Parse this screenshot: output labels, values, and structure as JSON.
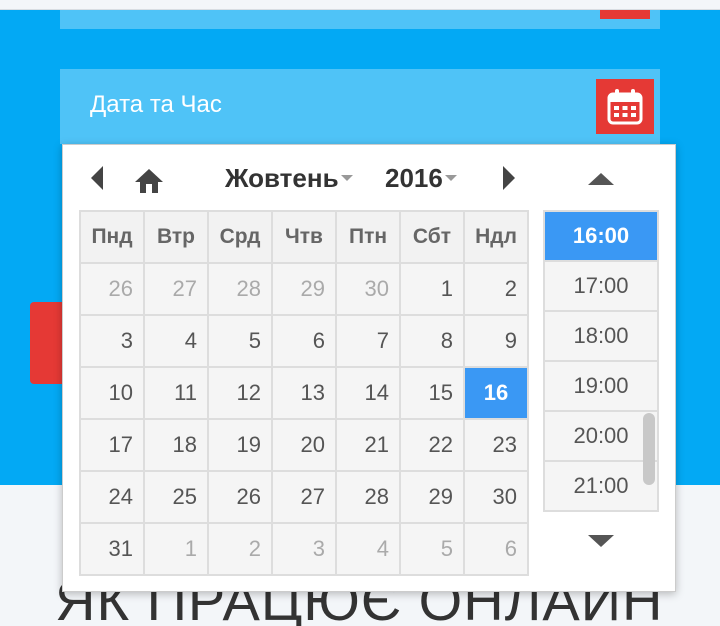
{
  "field": {
    "label": "Дата та Час",
    "calendar_icon": "calendar-icon"
  },
  "calendar": {
    "month": "Жовтень",
    "year": "2016",
    "weekdays": [
      "Пнд",
      "Втр",
      "Срд",
      "Чтв",
      "Птн",
      "Сбт",
      "Ндл"
    ],
    "weeks": [
      [
        "26",
        "27",
        "28",
        "29",
        "30",
        "1",
        "2"
      ],
      [
        "3",
        "4",
        "5",
        "6",
        "7",
        "8",
        "9"
      ],
      [
        "10",
        "11",
        "12",
        "13",
        "14",
        "15",
        "16"
      ],
      [
        "17",
        "18",
        "19",
        "20",
        "21",
        "22",
        "23"
      ],
      [
        "24",
        "25",
        "26",
        "27",
        "28",
        "29",
        "30"
      ],
      [
        "31",
        "1",
        "2",
        "3",
        "4",
        "5",
        "6"
      ]
    ],
    "selected_day": "16"
  },
  "time": {
    "slots": [
      "16:00",
      "17:00",
      "18:00",
      "19:00",
      "20:00",
      "21:00"
    ],
    "selected": "16:00"
  },
  "page": {
    "heading": "ЯК ПРАЦЮЄ ОНЛАЙН"
  },
  "colors": {
    "primary_blue": "#03a9f4",
    "field_blue": "#4fc3f7",
    "accent_red": "#e53935",
    "selected_blue": "#3a98f4"
  }
}
